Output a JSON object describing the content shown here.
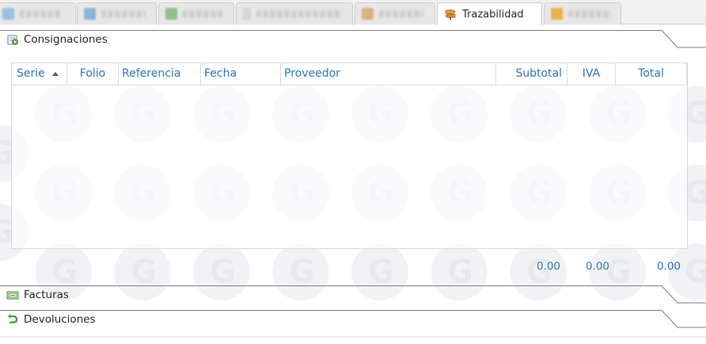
{
  "tabs": [
    {
      "name": "tab-1",
      "label": "",
      "blurred": true,
      "icon_color": "#9ec0df"
    },
    {
      "name": "tab-2",
      "label": "",
      "blurred": true,
      "icon_color": "#8fb3d8"
    },
    {
      "name": "tab-3",
      "label": "",
      "blurred": true,
      "icon_color": "#8fbf8a"
    },
    {
      "name": "tab-4",
      "label": "",
      "blurred": true,
      "icon_color": "#d5d5d5"
    },
    {
      "name": "tab-5",
      "label": "",
      "blurred": true,
      "icon_color": "#d9b27e"
    },
    {
      "name": "tab-trazabilidad",
      "label": "Trazabilidad",
      "blurred": false,
      "icon": "signpost-icon"
    },
    {
      "name": "tab-7",
      "label": "",
      "blurred": true,
      "icon_color": "#e8b34a"
    }
  ],
  "sections": {
    "consignaciones": {
      "label": "Consignaciones",
      "icon": "gear-document-icon"
    },
    "facturas": {
      "label": "Facturas",
      "icon": "invoice-icon"
    },
    "devoluciones": {
      "label": "Devoluciones",
      "icon": "return-arrow-icon"
    }
  },
  "grid": {
    "columns": [
      "Serie",
      "Folio",
      "Referencia",
      "Fecha",
      "Proveedor",
      "Subtotal",
      "IVA",
      "Total"
    ],
    "sorted_column": "Serie",
    "sort_direction": "ascending",
    "rows": []
  },
  "totals": {
    "subtotal": "0.00",
    "iva": "0.00",
    "total": "0.00"
  },
  "colors": {
    "header_text": "#2e73b0",
    "border": "#cfcfcf"
  }
}
